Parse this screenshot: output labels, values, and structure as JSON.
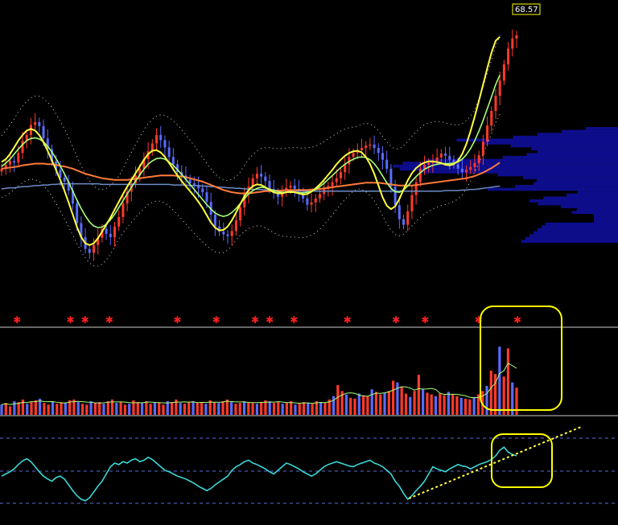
{
  "last_price_label": "68.57",
  "colors": {
    "background": "#000000",
    "up_candle": "#ff3a2a",
    "down_candle": "#5a6bff",
    "ma_fast": "#ffff40",
    "ma_mid": "#a8ff7a",
    "ma_slow": "#ff7a3a",
    "ma_long": "#6c8cc8",
    "band": "#d8d8d8",
    "volume_profile": "#0d0d8c",
    "oscillator": "#3cd6d6",
    "signal_star": "#ff2020",
    "highlight": "#ffff00",
    "trendline": "#ffff40"
  },
  "chart_data": [
    {
      "type": "candlestick",
      "panel": "price",
      "x_index_range": [
        0,
        160
      ],
      "ylim": [
        24,
        72
      ],
      "close": [
        44.8,
        45.5,
        46.2,
        45.9,
        47.6,
        49.8,
        50.8,
        52.6,
        53.1,
        52.4,
        50.2,
        48.3,
        46.1,
        44.6,
        43.2,
        42.5,
        40.9,
        38.6,
        35.1,
        32.6,
        30.5,
        29.8,
        31.2,
        32.5,
        34.1,
        33.2,
        32.6,
        34.5,
        36.2,
        38.6,
        40.7,
        42.2,
        43.6,
        44.8,
        46.5,
        47.9,
        49.3,
        50.8,
        49.9,
        48.6,
        46.9,
        45.6,
        44.2,
        43.6,
        42.9,
        42.2,
        41.8,
        41.3,
        40.6,
        38.9,
        36.6,
        34.5,
        33.6,
        33.1,
        32.8,
        33.7,
        35.6,
        37.9,
        40.3,
        41.6,
        43.1,
        43.9,
        43.4,
        42.6,
        41.2,
        40.5,
        39.8,
        40.6,
        41.4,
        41.8,
        41.2,
        40.6,
        39.5,
        38.4,
        38.8,
        39.5,
        40.3,
        41.2,
        41.7,
        42.4,
        43.1,
        44.2,
        45.6,
        46.9,
        47.6,
        48.1,
        48.5,
        48.9,
        49.1,
        48.5,
        47.6,
        46.4,
        44.8,
        41.6,
        38.3,
        35.8,
        34.8,
        37.2,
        40.1,
        42.4,
        44.8,
        45.5,
        45.8,
        46.2,
        46.8,
        47.5,
        47.1,
        46.4,
        45.6,
        44.8,
        44.2,
        44.6,
        45.1,
        45.8,
        47.2,
        49.6,
        52.5,
        55.1,
        57.8,
        60.5,
        63.4,
        66.2,
        68.0,
        68.57
      ],
      "ma_fast": [
        46.0,
        46.5,
        47.4,
        48.6,
        49.8,
        50.8,
        51.6,
        51.9,
        51.6,
        50.8,
        49.5,
        48.0,
        46.3,
        44.6,
        42.8,
        40.9,
        38.8,
        36.6,
        34.4,
        32.6,
        31.5,
        31.2,
        31.5,
        32.4,
        33.6,
        34.8,
        36.1,
        37.5,
        38.9,
        40.3,
        41.6,
        42.8,
        44.0,
        45.2,
        46.4,
        47.4,
        48.0,
        48.1,
        47.7,
        46.9,
        45.8,
        44.7,
        43.6,
        42.6,
        41.7,
        40.8,
        39.9,
        38.9,
        37.8,
        36.5,
        35.2,
        34.3,
        33.8,
        33.9,
        34.5,
        35.6,
        37.0,
        38.5,
        39.9,
        41.0,
        41.7,
        42.0,
        41.9,
        41.5,
        41.0,
        40.6,
        40.4,
        40.4,
        40.6,
        40.7,
        40.6,
        40.4,
        40.2,
        40.3,
        40.7,
        41.3,
        42.0,
        42.8,
        43.7,
        44.6,
        45.6,
        46.4,
        47.1,
        47.6,
        47.9,
        48.0,
        47.7,
        46.9,
        45.6,
        43.9,
        41.8,
        39.7,
        38.2,
        37.6,
        38.1,
        39.4,
        41.1,
        42.7,
        44.0,
        44.9,
        45.5,
        45.9,
        46.1,
        46.1,
        46.0,
        45.8,
        45.5,
        45.4,
        45.6,
        46.2,
        47.4,
        49.2,
        51.5,
        54.1,
        56.9,
        59.8,
        62.7,
        65.5,
        67.6,
        68.3
      ],
      "ma_mid": [
        45.2,
        45.8,
        46.5,
        47.4,
        48.3,
        49.1,
        49.8,
        50.2,
        50.3,
        50.1,
        49.6,
        48.8,
        47.8,
        46.6,
        45.3,
        43.9,
        42.4,
        40.8,
        39.2,
        37.7,
        36.4,
        35.3,
        34.6,
        34.3,
        34.4,
        34.9,
        35.7,
        36.7,
        37.9,
        39.1,
        40.3,
        41.5,
        42.6,
        43.7,
        44.7,
        45.6,
        46.2,
        46.6,
        46.7,
        46.5,
        46.0,
        45.4,
        44.6,
        43.8,
        42.9,
        42.0,
        41.1,
        40.2,
        39.3,
        38.4,
        37.6,
        36.9,
        36.5,
        36.3,
        36.5,
        37.0,
        37.7,
        38.6,
        39.5,
        40.3,
        40.9,
        41.3,
        41.5,
        41.4,
        41.2,
        40.9,
        40.7,
        40.6,
        40.6,
        40.6,
        40.6,
        40.5,
        40.5,
        40.6,
        40.8,
        41.1,
        41.6,
        42.2,
        42.9,
        43.6,
        44.3,
        45.0,
        45.6,
        46.1,
        46.5,
        46.8,
        46.9,
        46.8,
        46.4,
        45.7,
        44.7,
        43.5,
        42.3,
        41.3,
        40.7,
        40.6,
        41.0,
        41.7,
        42.6,
        43.4,
        44.1,
        44.7,
        45.1,
        45.4,
        45.6,
        45.7,
        45.7,
        45.7,
        45.8,
        46.0,
        46.5,
        47.3,
        48.4,
        49.8,
        51.5,
        53.4,
        55.5,
        57.6,
        59.8,
        61.5
      ],
      "ma_slow": [
        44.8,
        44.9,
        45.0,
        45.1,
        45.2,
        45.4,
        45.5,
        45.6,
        45.7,
        45.7,
        45.7,
        45.6,
        45.6,
        45.5,
        45.3,
        45.2,
        45.0,
        44.8,
        44.5,
        44.2,
        43.9,
        43.7,
        43.5,
        43.3,
        43.1,
        43.0,
        42.9,
        42.8,
        42.8,
        42.8,
        42.8,
        42.9,
        43.0,
        43.1,
        43.2,
        43.3,
        43.4,
        43.5,
        43.6,
        43.6,
        43.6,
        43.6,
        43.5,
        43.4,
        43.3,
        43.1,
        42.9,
        42.7,
        42.5,
        42.2,
        41.9,
        41.6,
        41.3,
        41.0,
        40.8,
        40.6,
        40.5,
        40.4,
        40.4,
        40.4,
        40.5,
        40.6,
        40.7,
        40.8,
        40.8,
        40.9,
        40.9,
        40.9,
        41.0,
        41.0,
        41.0,
        41.0,
        41.0,
        41.0,
        41.1,
        41.1,
        41.2,
        41.3,
        41.4,
        41.5,
        41.6,
        41.7,
        41.8,
        41.9,
        42.0,
        42.1,
        42.2,
        42.3,
        42.3,
        42.3,
        42.3,
        42.2,
        42.1,
        42.0,
        41.9,
        41.8,
        41.8,
        41.8,
        41.8,
        41.9,
        42.0,
        42.1,
        42.2,
        42.3,
        42.4,
        42.5,
        42.6,
        42.7,
        42.8,
        42.9,
        43.0,
        43.1,
        43.3,
        43.5,
        43.8,
        44.1,
        44.5,
        44.9,
        45.4,
        45.9
      ],
      "ma_long": [
        41.2,
        41.3,
        41.4,
        41.4,
        41.5,
        41.6,
        41.6,
        41.7,
        41.8,
        41.8,
        41.9,
        41.9,
        42.0,
        42.0,
        42.1,
        42.1,
        42.1,
        42.1,
        42.1,
        42.1,
        42.1,
        42.1,
        42.1,
        42.1,
        42.0,
        42.0,
        42.0,
        42.0,
        42.0,
        42.0,
        42.0,
        42.0,
        42.0,
        42.0,
        42.0,
        42.0,
        42.0,
        42.0,
        42.0,
        42.0,
        42.0,
        41.9,
        41.9,
        41.9,
        41.9,
        41.8,
        41.8,
        41.8,
        41.7,
        41.7,
        41.6,
        41.6,
        41.5,
        41.5,
        41.4,
        41.4,
        41.3,
        41.3,
        41.2,
        41.2,
        41.1,
        41.1,
        41.1,
        41.0,
        41.0,
        40.9,
        40.9,
        40.9,
        40.9,
        40.8,
        40.8,
        40.8,
        40.8,
        40.8,
        40.8,
        40.8,
        40.8,
        40.8,
        40.8,
        40.8,
        40.8,
        40.8,
        40.8,
        40.8,
        40.8,
        40.8,
        40.8,
        40.8,
        40.8,
        40.8,
        40.8,
        40.8,
        40.8,
        40.8,
        40.8,
        40.8,
        40.8,
        40.8,
        40.8,
        40.8,
        40.8,
        40.8,
        40.8,
        40.8,
        40.8,
        40.8,
        40.9,
        40.9,
        40.9,
        40.9,
        41.0,
        41.0,
        41.1,
        41.1,
        41.2,
        41.3,
        41.4,
        41.5,
        41.6,
        41.7
      ]
    },
    {
      "type": "bar",
      "panel": "volume",
      "ylim": [
        0,
        100
      ],
      "values": [
        12,
        14,
        10,
        16,
        15,
        18,
        13,
        15,
        17,
        19,
        14,
        12,
        16,
        13,
        15,
        14,
        17,
        18,
        15,
        13,
        12,
        16,
        14,
        15,
        13,
        16,
        18,
        14,
        15,
        12,
        13,
        17,
        15,
        14,
        16,
        13,
        15,
        14,
        12,
        16,
        15,
        18,
        14,
        13,
        15,
        16,
        14,
        15,
        13,
        17,
        15,
        14,
        16,
        18,
        15,
        13,
        14,
        16,
        15,
        14,
        13,
        15,
        17,
        16,
        14,
        15,
        13,
        14,
        16,
        12,
        13,
        15,
        14,
        13,
        16,
        15,
        14,
        18,
        22,
        35,
        28,
        24,
        20,
        19,
        25,
        23,
        22,
        30,
        27,
        24,
        26,
        28,
        40,
        38,
        33,
        25,
        21,
        28,
        47,
        30,
        26,
        24,
        22,
        25,
        23,
        27,
        24,
        22,
        20,
        19,
        18,
        21,
        24,
        28,
        34,
        52,
        48,
        80,
        45,
        78,
        38,
        32
      ]
    },
    {
      "type": "line",
      "panel": "oscillator",
      "ylim": [
        0,
        100
      ],
      "values": [
        42,
        45,
        48,
        52,
        58,
        63,
        66,
        62,
        55,
        48,
        42,
        38,
        35,
        40,
        42,
        38,
        30,
        22,
        15,
        10,
        8,
        12,
        20,
        28,
        35,
        45,
        55,
        60,
        58,
        62,
        60,
        64,
        66,
        62,
        64,
        68,
        65,
        60,
        55,
        50,
        48,
        45,
        42,
        40,
        38,
        35,
        32,
        28,
        25,
        22,
        25,
        30,
        34,
        38,
        42,
        50,
        55,
        58,
        62,
        64,
        60,
        58,
        55,
        52,
        48,
        45,
        50,
        55,
        60,
        58,
        55,
        52,
        48,
        45,
        42,
        45,
        50,
        55,
        58,
        60,
        62,
        60,
        58,
        56,
        55,
        58,
        60,
        62,
        64,
        60,
        58,
        55,
        50,
        45,
        35,
        28,
        18,
        10,
        15,
        22,
        28,
        35,
        45,
        55,
        52,
        50,
        48,
        52,
        55,
        58,
        56,
        55,
        52,
        55,
        58,
        60,
        62,
        65,
        70,
        78,
        82,
        75,
        72,
        70
      ]
    },
    {
      "type": "scatter",
      "panel": "signals",
      "x": [
        3,
        14,
        17,
        22,
        36,
        44,
        52,
        55,
        60,
        71,
        81,
        87,
        98,
        106
      ]
    }
  ]
}
